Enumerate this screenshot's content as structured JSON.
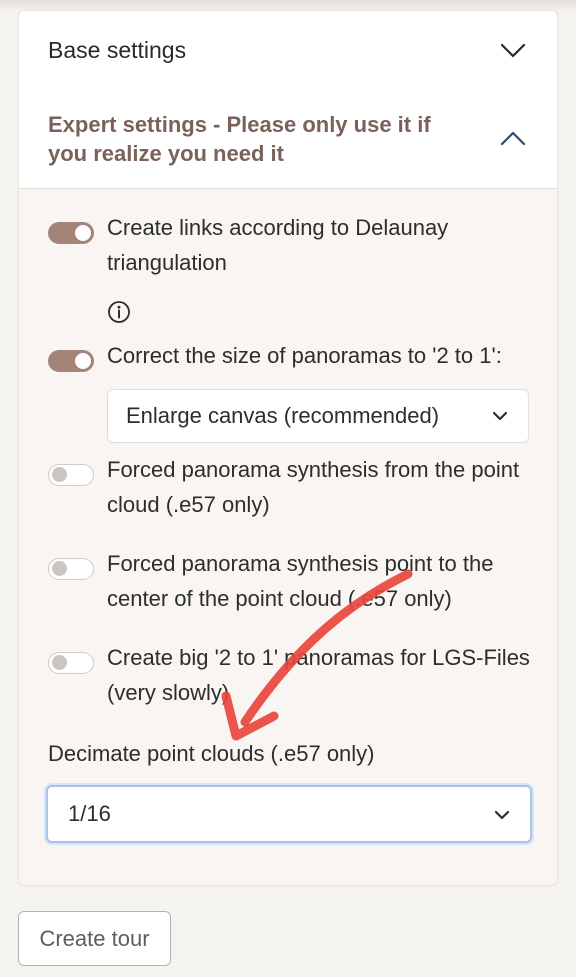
{
  "accordion": {
    "base_settings": {
      "title": "Base settings",
      "expanded": false,
      "icon": "chevron-down-icon"
    },
    "expert_settings": {
      "title": "Expert settings - Please only use it if you realize you need it",
      "expanded": true,
      "icon": "chevron-up-icon",
      "title_color": "#7a625a"
    }
  },
  "options": [
    {
      "label": "Create links according to Delaunay triangulation",
      "enabled": true,
      "has_info_icon": true
    },
    {
      "label": "Correct the size of panoramas to '2 to 1':",
      "enabled": true,
      "select_value": "Enlarge canvas (recommended)"
    },
    {
      "label": "Forced panorama synthesis from the point cloud (.e57 only)",
      "enabled": false
    },
    {
      "label": "Forced panorama synthesis point to the center of the point cloud (.e57 only)",
      "enabled": false
    },
    {
      "label": "Create big '2 to 1' panoramas for LGS-Files (very slowly)",
      "enabled": false
    }
  ],
  "decimate": {
    "label": "Decimate point clouds (.e57 only)",
    "value": "1/16"
  },
  "create_button": {
    "label": "Create tour"
  },
  "colors": {
    "toggle_on": "#a58478",
    "focus_ring": "#a9c4e6",
    "annotation_arrow": "#e8453c"
  }
}
